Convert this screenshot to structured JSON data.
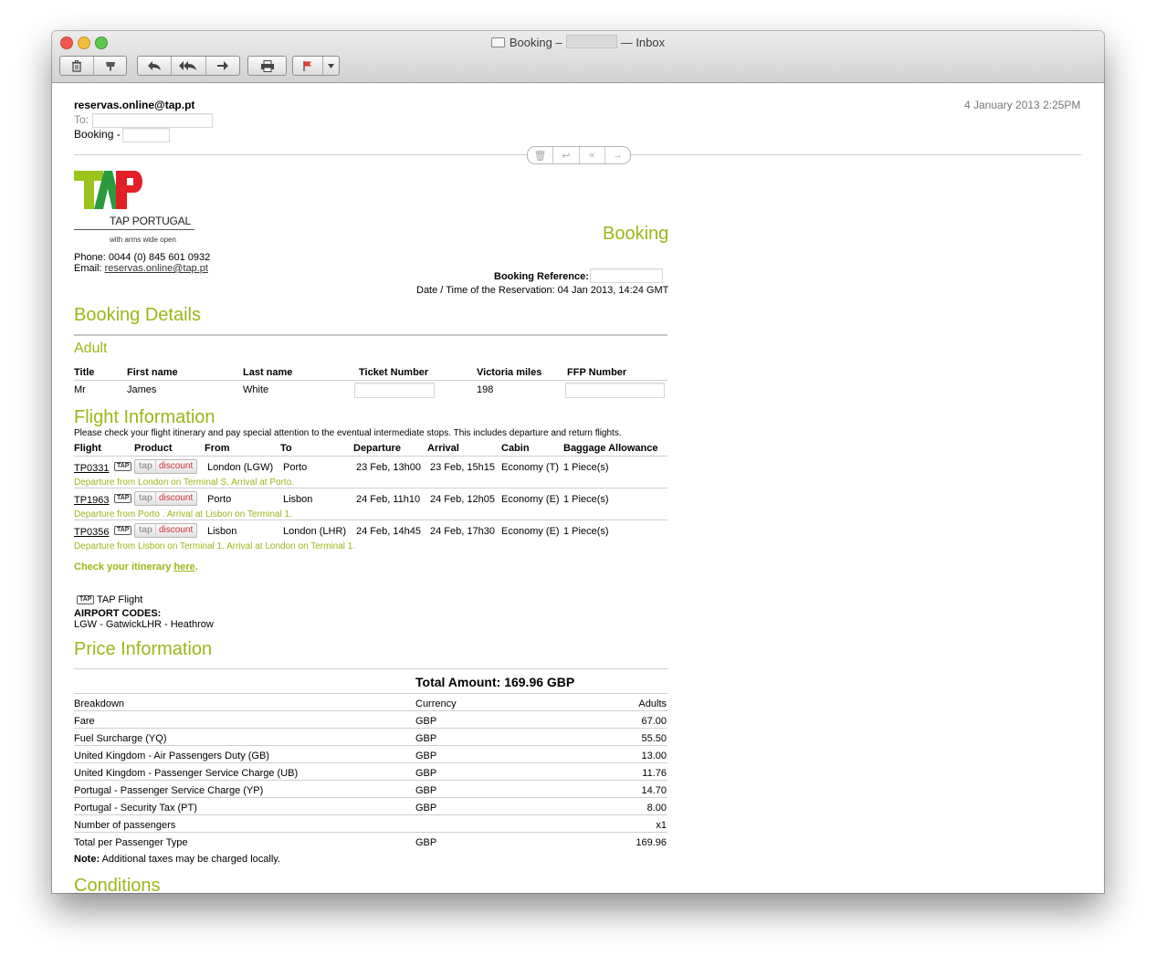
{
  "window": {
    "title_prefix": "Booking –",
    "title_suffix": "— Inbox"
  },
  "toolbar": {
    "icons": [
      "trash-icon",
      "junk-icon",
      "reply-icon",
      "reply-all-icon",
      "forward-icon",
      "print-icon",
      "flag-icon",
      "dropdown-arrow-icon"
    ]
  },
  "header": {
    "from": "reservas.online@tap.pt",
    "to_label": "To:",
    "subject": "Booking -",
    "date": "4 January 2013 2:25PM"
  },
  "logo": {
    "letters": "TAP",
    "name": "TAP PORTUGAL",
    "tagline": "with arms wide open"
  },
  "contact": {
    "phone": "Phone: 0044 (0) 845 601 0932",
    "email_label": "Email:",
    "email": "reservas.online@tap.pt"
  },
  "booking": {
    "title": "Booking",
    "reference_label": "Booking Reference:",
    "datetime": "Date / Time of the Reservation: 04 Jan 2013, 14:24 GMT"
  },
  "booking_details": {
    "title": "Booking Details",
    "subtitle": "Adult",
    "headers": [
      "Title",
      "First name",
      "Last name",
      "Ticket Number",
      "Victoria miles",
      "FFP Number"
    ],
    "row": {
      "title": "Mr",
      "first": "James",
      "last": "White",
      "miles": "198"
    }
  },
  "flight_info": {
    "title": "Flight Information",
    "note": "Please check your flight itinerary and pay special attention to the eventual intermediate stops. This includes departure and return flights.",
    "headers": [
      "Flight",
      "Product",
      "From",
      "To",
      "Departure",
      "Arrival",
      "Cabin",
      "Baggage Allowance"
    ],
    "tap_tag": "TAP",
    "product_part1": "tap",
    "product_part2": "discount",
    "rows": [
      {
        "flight": "TP0331",
        "from": "London (LGW)",
        "to": "Porto",
        "dep": "23 Feb, 13h00",
        "arr": "23 Feb, 15h15",
        "cabin": "Economy (T)",
        "bag": "1 Piece(s)",
        "note": "Departure from London on Terminal S. Arrival at Porto."
      },
      {
        "flight": "TP1963",
        "from": "Porto",
        "to": "Lisbon",
        "dep": "24 Feb, 11h10",
        "arr": "24 Feb, 12h05",
        "cabin": "Economy (E)",
        "bag": "1 Piece(s)",
        "note": "Departure from Porto . Arrival at Lisbon on Terminal 1."
      },
      {
        "flight": "TP0356",
        "from": "Lisbon",
        "to": "London (LHR)",
        "dep": "24 Feb, 14h45",
        "arr": "24 Feb, 17h30",
        "cabin": "Economy (E)",
        "bag": "1 Piece(s)",
        "note": "Departure from Lisbon on Terminal 1. Arrival at London on Terminal 1."
      }
    ],
    "check_text": "Check your itinerary",
    "check_link": "here",
    "check_end": ".",
    "legend": "TAP Flight",
    "airport_codes_label": "AIRPORT CODES:",
    "airport_codes": "LGW - GatwickLHR - Heathrow"
  },
  "price_info": {
    "title": "Price Information",
    "total": "Total Amount: 169.96 GBP",
    "headers": [
      "Breakdown",
      "Currency",
      "Adults"
    ],
    "rows": [
      {
        "label": "Fare",
        "currency": "GBP",
        "amount": "67.00"
      },
      {
        "label": "Fuel Surcharge (YQ)",
        "currency": "GBP",
        "amount": "55.50"
      },
      {
        "label": "United Kingdom - Air Passengers Duty (GB)",
        "currency": "GBP",
        "amount": "13.00"
      },
      {
        "label": "United Kingdom - Passenger Service Charge (UB)",
        "currency": "GBP",
        "amount": "11.76"
      },
      {
        "label": "Portugal - Passenger Service Charge (YP)",
        "currency": "GBP",
        "amount": "14.70"
      },
      {
        "label": "Portugal - Security Tax (PT)",
        "currency": "GBP",
        "amount": "8.00"
      },
      {
        "label": "Number of passengers",
        "currency": "",
        "amount": "x1"
      },
      {
        "label": "Total per Passenger Type",
        "currency": "GBP",
        "amount": "169.96"
      }
    ],
    "note_label": "Note:",
    "note": "Additional taxes may be charged locally."
  },
  "conditions": {
    "title": "Conditions"
  }
}
